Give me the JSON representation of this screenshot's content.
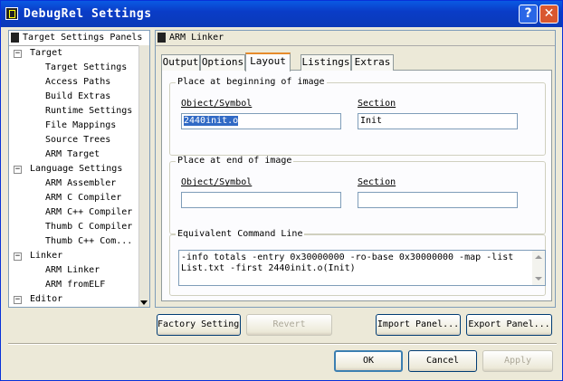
{
  "window": {
    "title": "DebugRel Settings",
    "help_glyph": "?",
    "close_glyph": "✕"
  },
  "panels": {
    "header": "Target Settings Panels",
    "groups": [
      {
        "label": "Target",
        "items": [
          "Target Settings",
          "Access Paths",
          "Build Extras",
          "Runtime Settings",
          "File Mappings",
          "Source Trees",
          "ARM Target"
        ]
      },
      {
        "label": "Language Settings",
        "items": [
          "ARM Assembler",
          "ARM C Compiler",
          "ARM C++ Compiler",
          "Thumb C Compiler",
          "Thumb C++ Com..."
        ]
      },
      {
        "label": "Linker",
        "items": [
          "ARM Linker",
          "ARM fromELF"
        ]
      },
      {
        "label": "Editor",
        "items": []
      }
    ]
  },
  "pane": {
    "title": "ARM Linker",
    "tabs": [
      "Output",
      "Options",
      "Layout",
      "Listings",
      "Extras"
    ],
    "active_tab": "Layout",
    "begin_group": {
      "title": "Place at beginning of image",
      "object_label": "Object/Symbol",
      "object_value": "2440init.o",
      "section_label": "Section",
      "section_value": "Init"
    },
    "end_group": {
      "title": "Place at end of image",
      "object_label": "Object/Symbol",
      "object_value": "",
      "section_label": "Section",
      "section_value": ""
    },
    "command_group": {
      "title": "Equivalent Command Line",
      "text": "-info totals -entry 0x30000000 -ro-base 0x30000000 -map -list List.txt -first 2440init.o(Init)"
    }
  },
  "bottom_buttons": {
    "factory": "Factory Settings",
    "revert": "Revert",
    "import": "Import Panel...",
    "export": "Export Panel..."
  },
  "dialog_buttons": {
    "ok": "OK",
    "cancel": "Cancel",
    "apply": "Apply"
  }
}
